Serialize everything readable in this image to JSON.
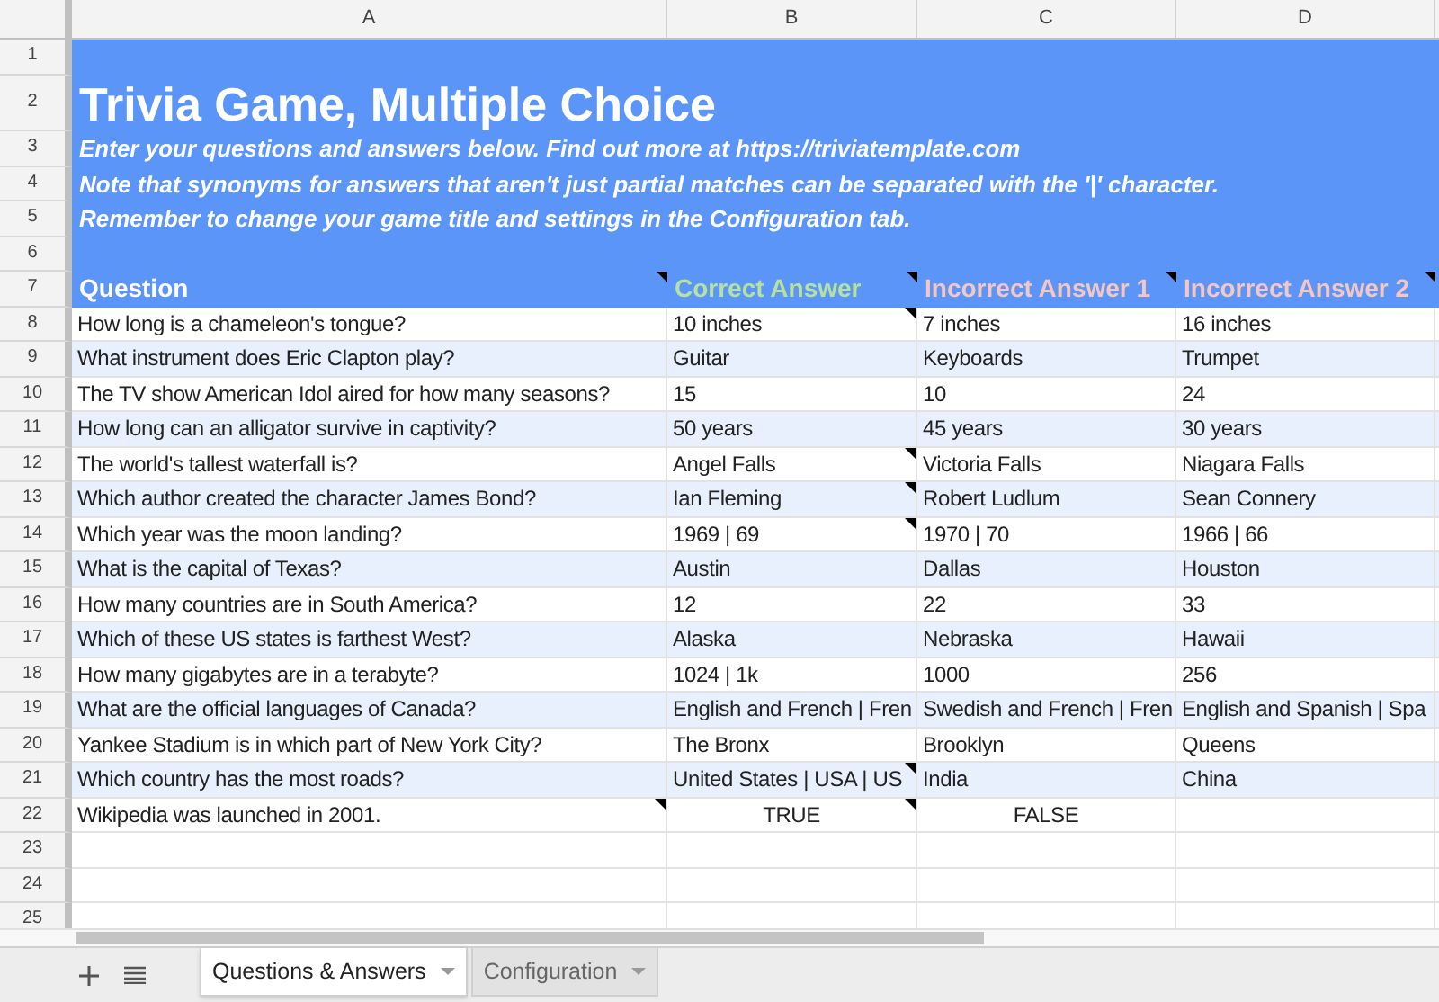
{
  "columns": [
    "A",
    "B",
    "C",
    "D"
  ],
  "row_numbers": [
    "1",
    "2",
    "3",
    "4",
    "5",
    "6",
    "7",
    "8",
    "9",
    "10",
    "11",
    "12",
    "13",
    "14",
    "15",
    "16",
    "17",
    "18",
    "19",
    "20",
    "21",
    "22",
    "23",
    "24",
    "25"
  ],
  "banner": {
    "title": "Trivia Game, Multiple Choice",
    "lines": [
      "Enter your questions and answers below. Find out more at https://triviatemplate.com",
      "Note that synonyms for answers that aren't just partial matches can be separated with the '|' character.",
      "Remember to change your game title and settings in the Configuration tab."
    ]
  },
  "header": [
    {
      "text": "Question",
      "color": "#ffffff",
      "note": true
    },
    {
      "text": "Correct Answer",
      "color": "#b7e1a1",
      "note": true
    },
    {
      "text": "Incorrect Answer 1",
      "color": "#f4c7c3",
      "note": true
    },
    {
      "text": "Incorrect Answer 2",
      "color": "#f4c7c3",
      "note": true
    }
  ],
  "rows": [
    {
      "cells": [
        {
          "text": "How long is a chameleon's tongue?"
        },
        {
          "text": "10 inches",
          "note": true
        },
        {
          "text": "7 inches"
        },
        {
          "text": "16 inches"
        }
      ]
    },
    {
      "cells": [
        {
          "text": "What instrument does Eric Clapton play?"
        },
        {
          "text": "Guitar"
        },
        {
          "text": "Keyboards"
        },
        {
          "text": "Trumpet"
        }
      ]
    },
    {
      "cells": [
        {
          "text": "The TV show American Idol aired for how many seasons?"
        },
        {
          "text": "15"
        },
        {
          "text": "10"
        },
        {
          "text": "24"
        }
      ]
    },
    {
      "cells": [
        {
          "text": "How long can an alligator survive in captivity?"
        },
        {
          "text": "50 years"
        },
        {
          "text": "45 years"
        },
        {
          "text": "30 years"
        }
      ]
    },
    {
      "cells": [
        {
          "text": "The world's tallest waterfall is?"
        },
        {
          "text": "Angel Falls",
          "note": true
        },
        {
          "text": "Victoria Falls"
        },
        {
          "text": "Niagara Falls"
        }
      ]
    },
    {
      "cells": [
        {
          "text": "Which author created the character James Bond?"
        },
        {
          "text": "Ian Fleming",
          "note": true
        },
        {
          "text": "Robert Ludlum"
        },
        {
          "text": "Sean Connery"
        }
      ]
    },
    {
      "cells": [
        {
          "text": "Which year was the moon landing?"
        },
        {
          "text": "1969 | 69",
          "note": true
        },
        {
          "text": "1970 | 70"
        },
        {
          "text": "1966 | 66"
        }
      ]
    },
    {
      "cells": [
        {
          "text": "What is the capital of Texas?"
        },
        {
          "text": "Austin"
        },
        {
          "text": "Dallas"
        },
        {
          "text": "Houston"
        }
      ]
    },
    {
      "cells": [
        {
          "text": "How many countries are in South America?"
        },
        {
          "text": "12"
        },
        {
          "text": "22"
        },
        {
          "text": "33"
        }
      ]
    },
    {
      "cells": [
        {
          "text": "Which of these US states is farthest West?"
        },
        {
          "text": "Alaska"
        },
        {
          "text": "Nebraska"
        },
        {
          "text": "Hawaii"
        }
      ]
    },
    {
      "cells": [
        {
          "text": "How many gigabytes are in a terabyte?"
        },
        {
          "text": "1024 | 1k"
        },
        {
          "text": "1000"
        },
        {
          "text": "256"
        }
      ]
    },
    {
      "cells": [
        {
          "text": "What are the official languages of Canada?"
        },
        {
          "text": "English and French | Fren"
        },
        {
          "text": "Swedish and French | Fren"
        },
        {
          "text": "English and Spanish | Spa"
        }
      ]
    },
    {
      "cells": [
        {
          "text": "Yankee Stadium is in which part of New York City?"
        },
        {
          "text": "The Bronx"
        },
        {
          "text": "Brooklyn"
        },
        {
          "text": "Queens"
        }
      ]
    },
    {
      "cells": [
        {
          "text": "Which country has the most roads?"
        },
        {
          "text": "United States | USA | US",
          "note": true
        },
        {
          "text": "India"
        },
        {
          "text": "China"
        }
      ]
    },
    {
      "cells": [
        {
          "text": "Wikipedia was launched in 2001.",
          "note": true
        },
        {
          "text": "TRUE",
          "kind": "boolean",
          "note": true
        },
        {
          "text": "FALSE",
          "kind": "boolean"
        },
        {}
      ]
    },
    {
      "cells": []
    },
    {
      "cells": []
    },
    {
      "cells": []
    }
  ],
  "sheet_tabs": [
    {
      "label": "Questions & Answers",
      "selected": true
    },
    {
      "label": "Configuration",
      "selected": false
    }
  ]
}
